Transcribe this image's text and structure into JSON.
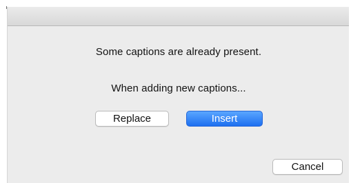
{
  "dialog": {
    "message": "Some captions are already present.",
    "prompt": "When adding new captions...",
    "buttons": {
      "replace": "Replace",
      "insert": "Insert",
      "cancel": "Cancel"
    }
  },
  "colors": {
    "dialog_background": "#ececec",
    "primary_button": "#1d6ff0",
    "default_button": "#ffffff"
  }
}
